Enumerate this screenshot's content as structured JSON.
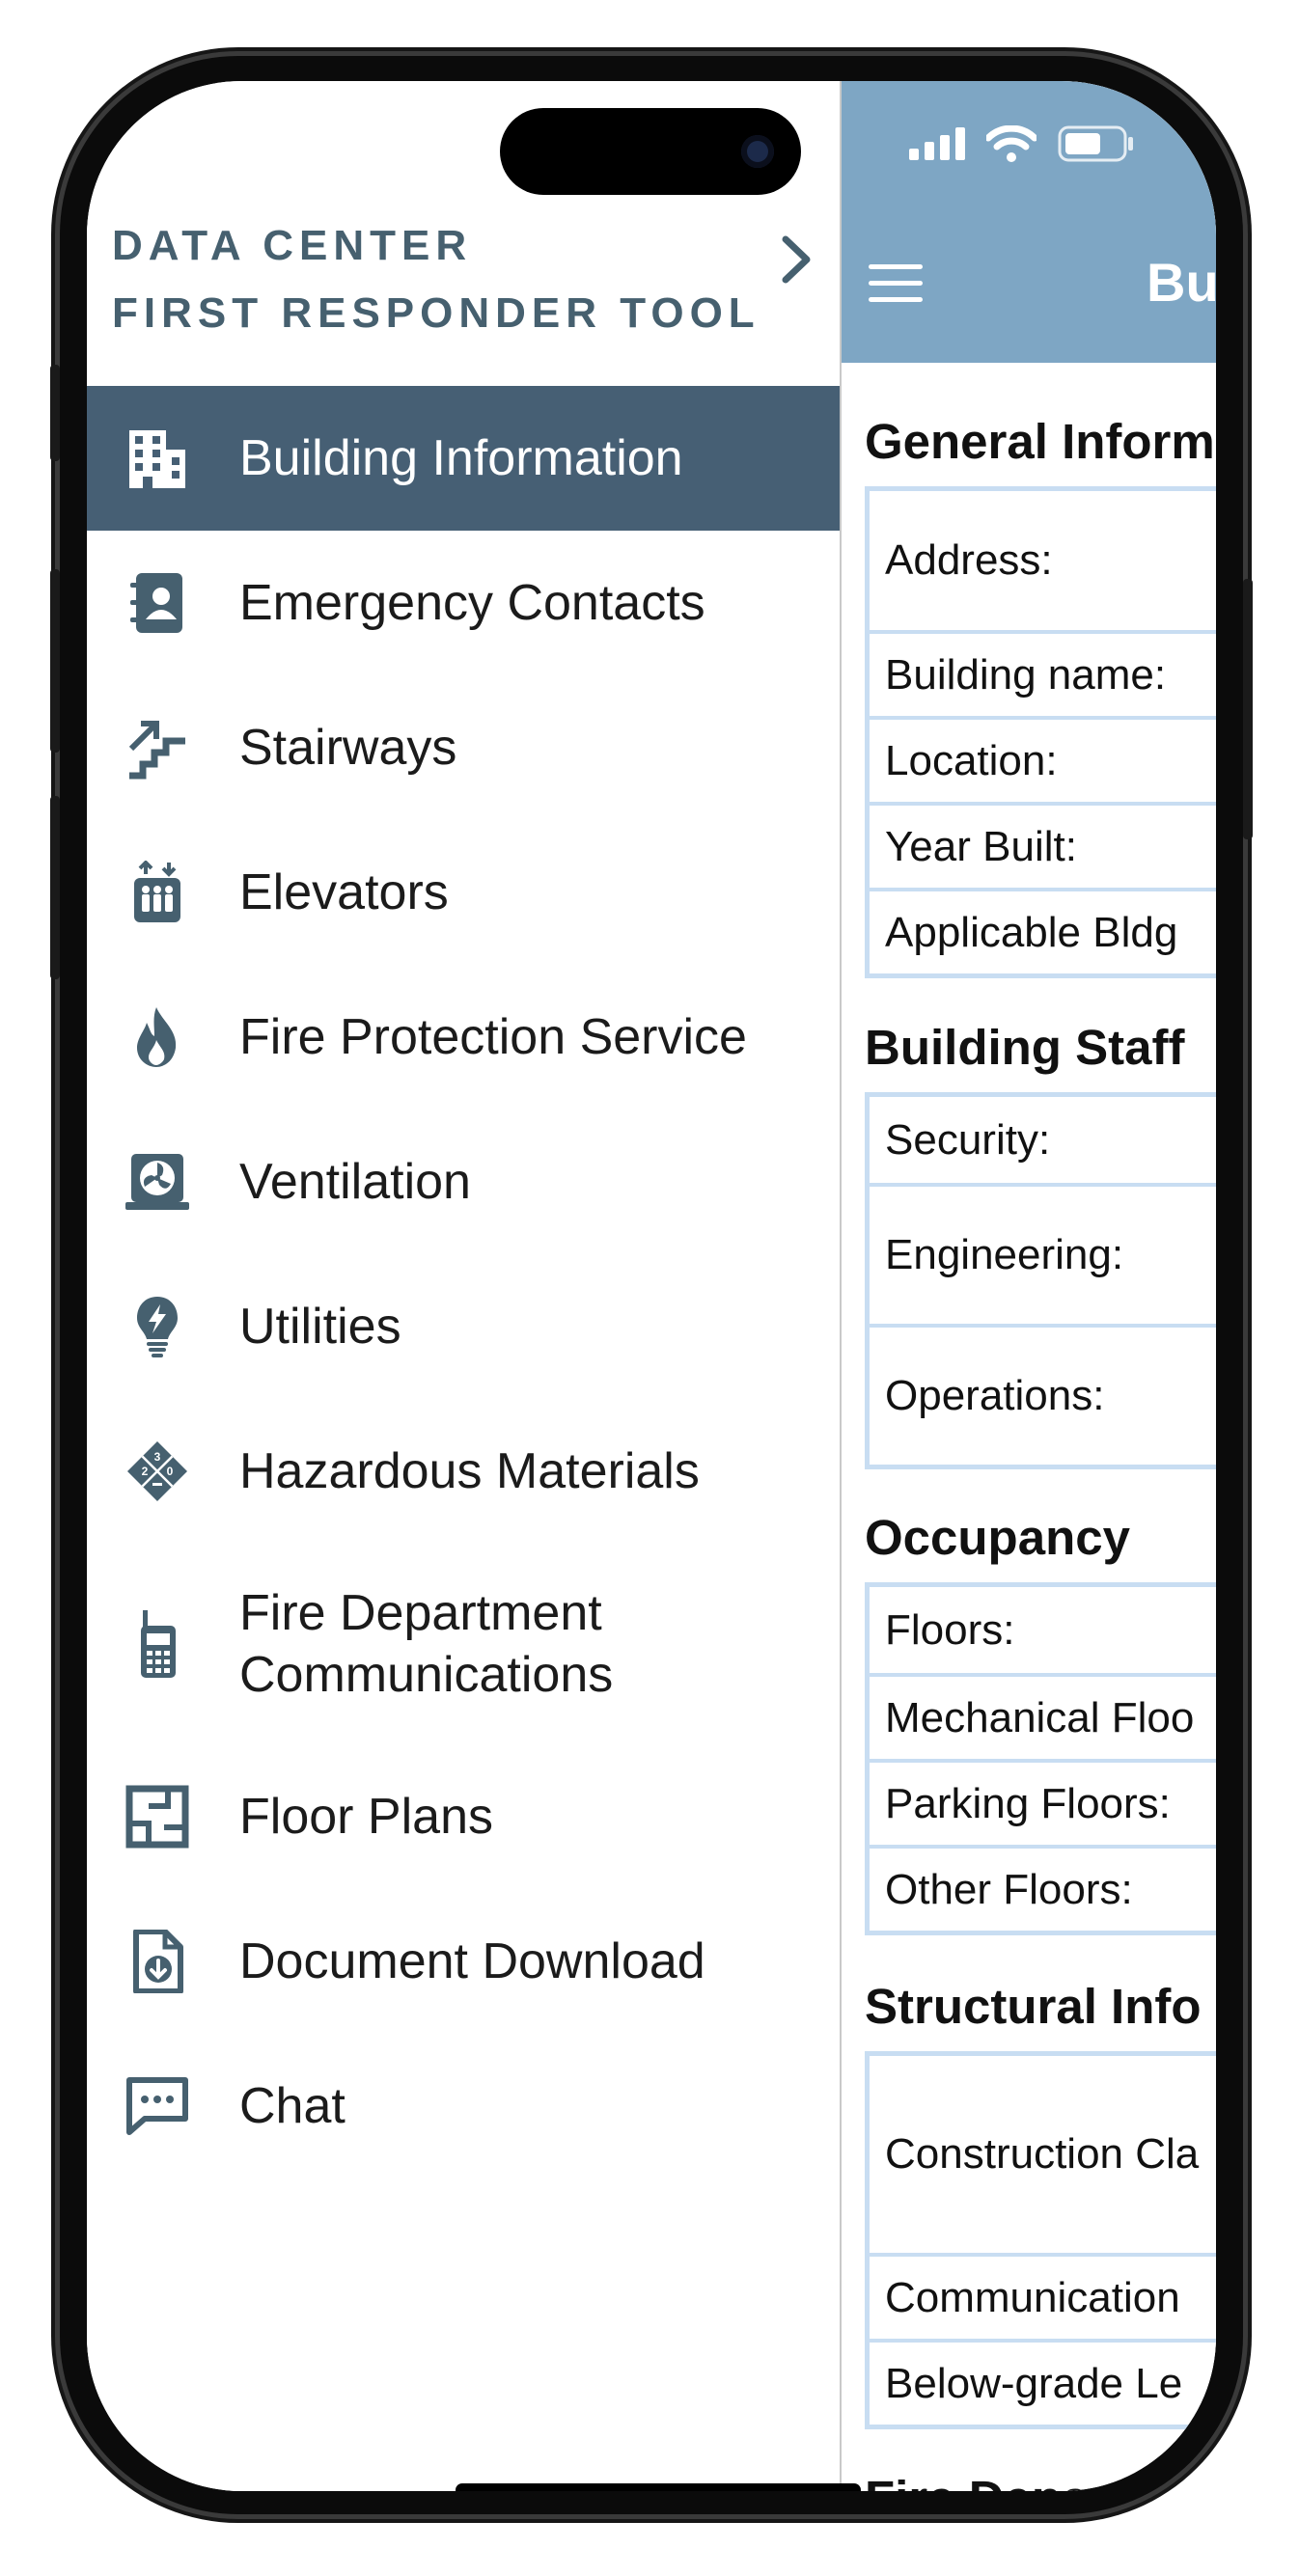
{
  "drawer": {
    "header_line1": "DATA CENTER",
    "header_line2": "FIRST RESPONDER TOOL",
    "items": [
      {
        "label": "Building Information",
        "icon": "building-icon",
        "active": true
      },
      {
        "label": "Emergency Contacts",
        "icon": "contact-book-icon"
      },
      {
        "label": "Stairways",
        "icon": "stairs-icon"
      },
      {
        "label": "Elevators",
        "icon": "elevator-icon"
      },
      {
        "label": "Fire Protection Service",
        "icon": "flame-icon"
      },
      {
        "label": "Ventilation",
        "icon": "fan-icon"
      },
      {
        "label": "Utilities",
        "icon": "lightbulb-icon"
      },
      {
        "label": "Hazardous Materials",
        "icon": "hazmat-diamond-icon"
      },
      {
        "label": "Fire Department Communications",
        "label_line1": "Fire Department",
        "label_line2": "Communications",
        "icon": "radio-icon"
      },
      {
        "label": "Floor Plans",
        "icon": "floor-plan-icon"
      },
      {
        "label": "Document Download",
        "icon": "document-download-icon"
      },
      {
        "label": "Chat",
        "icon": "chat-icon"
      }
    ]
  },
  "main": {
    "title": "Bu",
    "sections": [
      {
        "title": "General Inform",
        "rows": [
          "Address:",
          "Building name:",
          "Location:",
          "Year Built:",
          "Applicable Bldg"
        ]
      },
      {
        "title": "Building Staff",
        "rows": [
          "Security:",
          "Engineering:",
          "Operations:"
        ]
      },
      {
        "title": "Occupancy",
        "rows": [
          "Floors:",
          "Mechanical Floo",
          "Parking Floors:",
          "Other Floors:"
        ]
      },
      {
        "title": "Structural Info",
        "rows": [
          "Construction Cla",
          "Communication",
          "Below-grade Le"
        ]
      },
      {
        "title": "Fire Depar"
      }
    ]
  },
  "colors": {
    "drawer_active_bg": "#465f74",
    "topbar_bg": "#7ea6c4",
    "icon_color": "#46606f",
    "table_border": "#c8ddf2"
  }
}
